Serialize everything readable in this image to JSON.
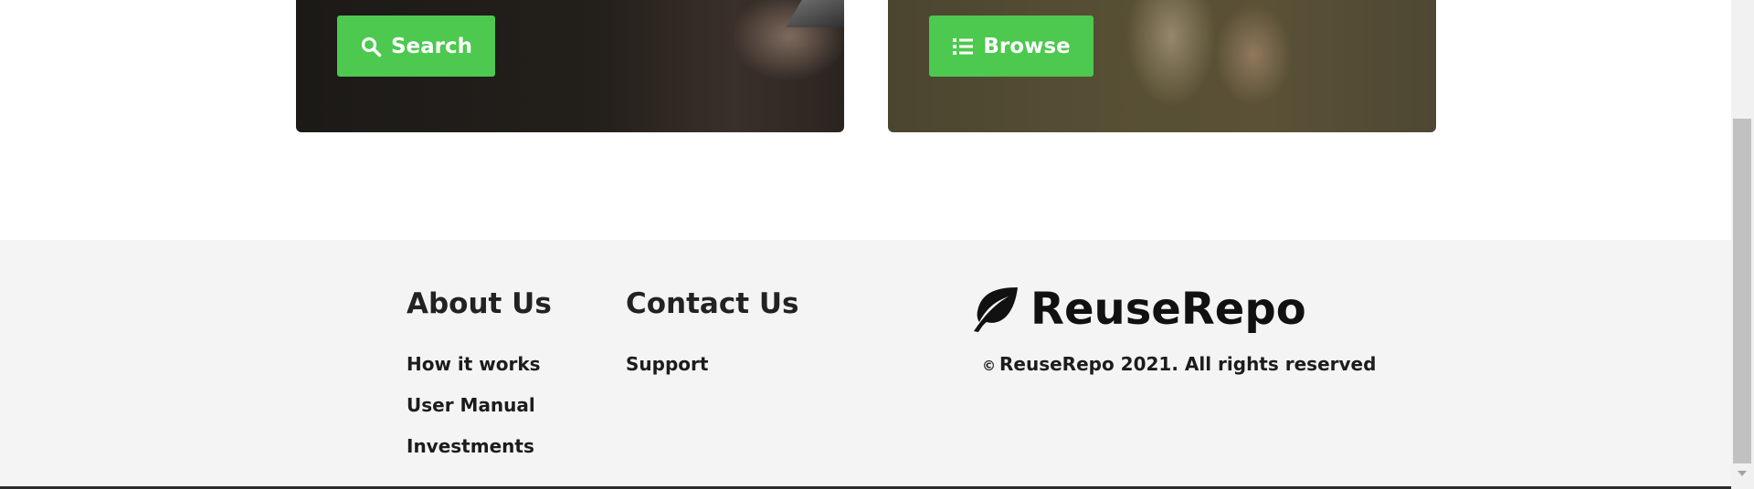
{
  "cards": {
    "search": {
      "button_label": "Search",
      "icon": "search-icon"
    },
    "browse": {
      "button_label": "Browse",
      "icon": "list-icon"
    }
  },
  "footer": {
    "about": {
      "title": "About Us",
      "links": [
        "How it works",
        "User Manual",
        "Investments"
      ]
    },
    "contact": {
      "title": "Contact Us",
      "links": [
        "Support"
      ]
    },
    "brand": {
      "name": "ReuseRepo",
      "logo_icon": "leaf-icon",
      "copyright_symbol": "©",
      "copyright_text": "ReuseRepo 2021. All rights reserved"
    }
  },
  "colors": {
    "accent_green": "#4cc94e",
    "footer_bg": "#f4f4f4",
    "text_dark": "#1c1c1c"
  }
}
